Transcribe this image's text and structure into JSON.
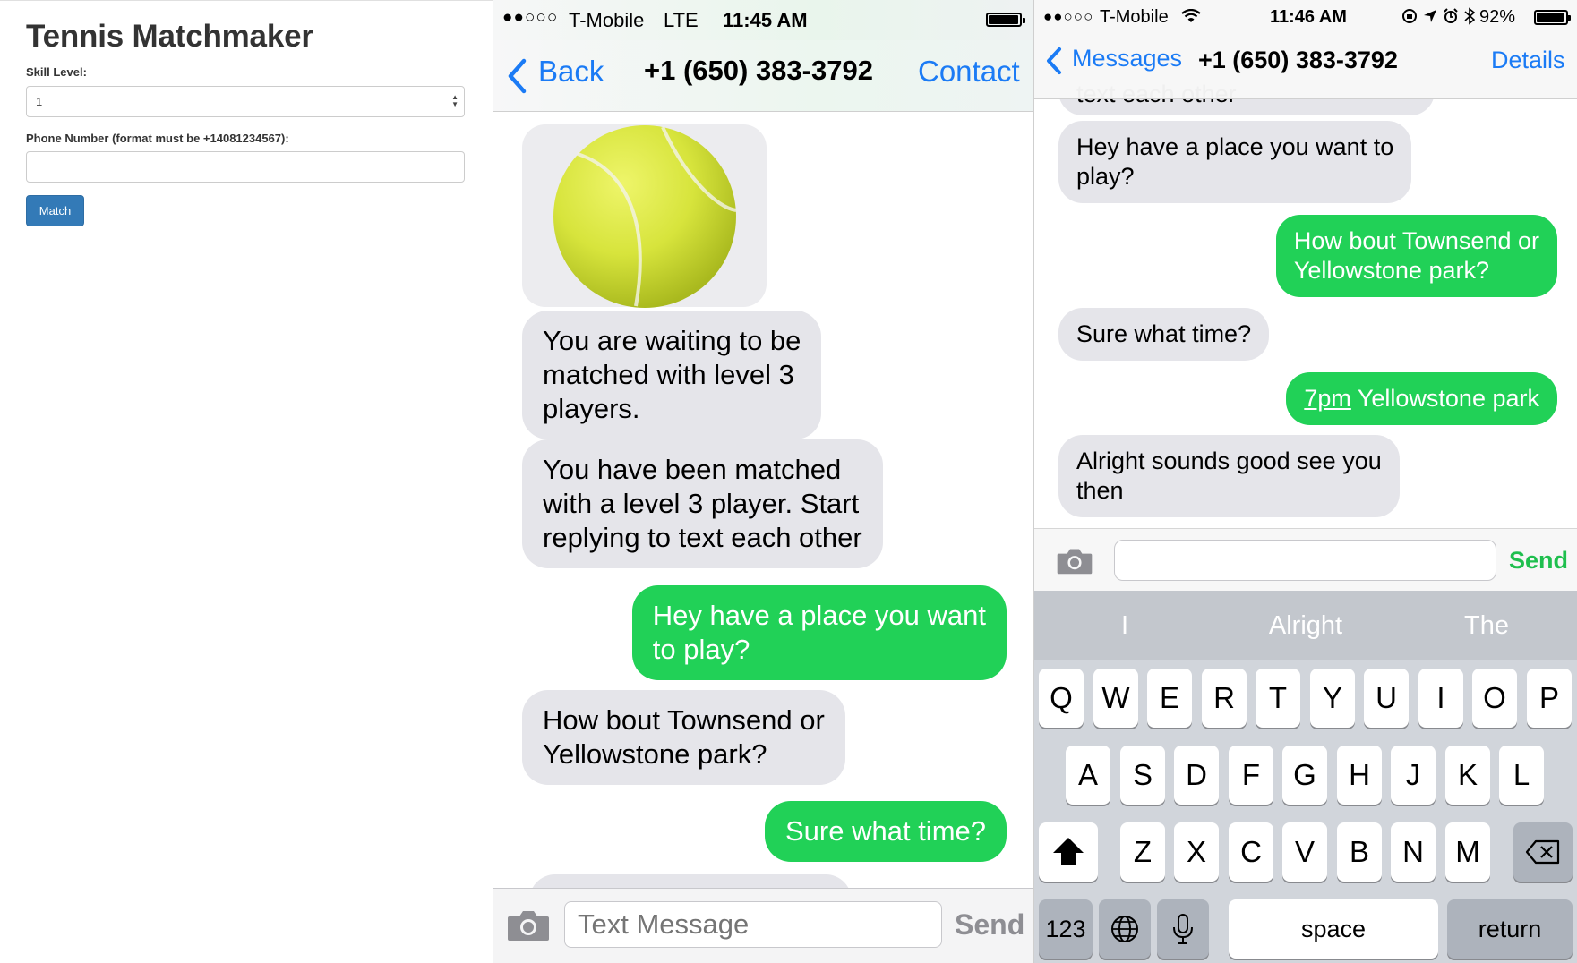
{
  "web_app": {
    "title": "Tennis Matchmaker",
    "skill_label": "Skill Level:",
    "skill_value": "1",
    "phone_label": "Phone Number (format must be +14081234567):",
    "phone_value": "",
    "match_button": "Match"
  },
  "phone_left": {
    "status": {
      "signal": "●●○○○",
      "carrier": "T-Mobile",
      "network": "LTE",
      "time": "11:45 AM"
    },
    "nav": {
      "back": "Back",
      "title": "+1 (650) 383-3792",
      "action": "Contact"
    },
    "messages": [
      {
        "from": "them",
        "text": "You are waiting to be\nmatched with level 3\nplayers."
      },
      {
        "from": "them",
        "text": "You have been matched\nwith a level 3 player. Start\nreplying to text each other"
      },
      {
        "from": "me",
        "text": "Hey have a place you want\nto play?"
      },
      {
        "from": "them",
        "text": "How bout Townsend or\nYellowstone  park?"
      },
      {
        "from": "me",
        "text": "Sure what time?"
      }
    ],
    "input_placeholder": "Text Message",
    "send": "Send",
    "colors": {
      "accent": "#1b7bf5",
      "outgoing": "#21d157",
      "incoming": "#e5e5ea"
    }
  },
  "phone_right": {
    "status": {
      "signal": "●●○○○",
      "carrier": "T-Mobile",
      "time": "11:46 AM",
      "battery": "92%"
    },
    "nav": {
      "back": "Messages",
      "title": "+1 (650) 383-3792",
      "action": "Details"
    },
    "messages": [
      {
        "from": "them",
        "text": "text each other"
      },
      {
        "from": "them",
        "text": "Hey have a place you want to\nplay?"
      },
      {
        "from": "me",
        "text": "How bout Townsend or\nYellowstone  park?"
      },
      {
        "from": "them",
        "text": "Sure what time?"
      },
      {
        "from": "me",
        "link": "7pm",
        "text": " Yellowstone park"
      },
      {
        "from": "them",
        "text": "Alright sounds good see you\nthen"
      }
    ],
    "send": "Send",
    "suggestions": [
      "I",
      "Alright",
      "The"
    ],
    "keyboard": {
      "row1": [
        "Q",
        "W",
        "E",
        "R",
        "T",
        "Y",
        "U",
        "I",
        "O",
        "P"
      ],
      "row2": [
        "A",
        "S",
        "D",
        "F",
        "G",
        "H",
        "J",
        "K",
        "L"
      ],
      "row3": [
        "Z",
        "X",
        "C",
        "V",
        "B",
        "N",
        "M"
      ],
      "numbers": "123",
      "space": "space",
      "return": "return"
    },
    "icons": [
      "wifi-icon",
      "orientation-lock-icon",
      "location-icon",
      "alarm-icon",
      "bluetooth-icon",
      "battery-icon",
      "camera-icon",
      "shift-icon",
      "delete-icon",
      "globe-icon",
      "microphone-icon"
    ]
  }
}
